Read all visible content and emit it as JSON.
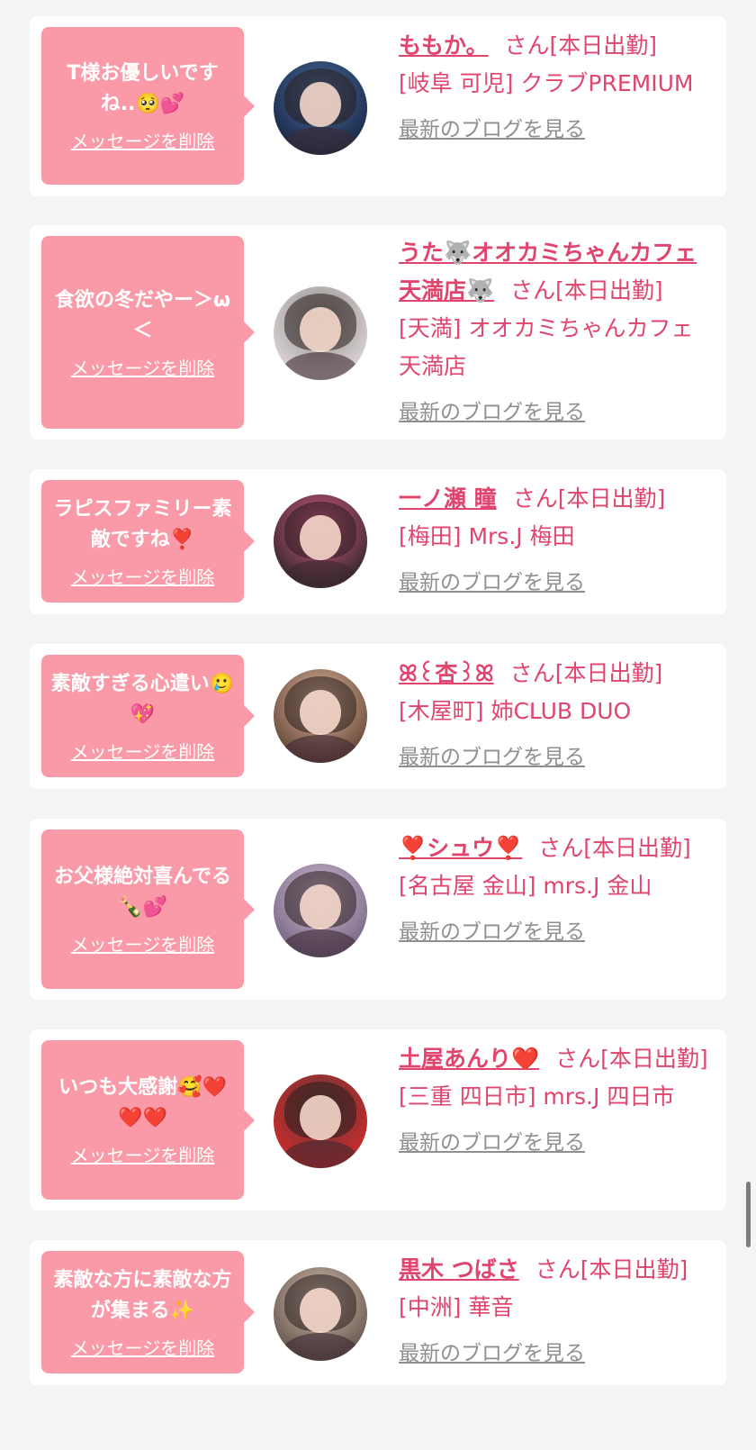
{
  "delete_label": "メッセージを削除",
  "blog_label": "最新のブログを見る",
  "san_suffix": "さん",
  "status_today": "[本日出勤]",
  "colors": {
    "bubble": "#fa9aa8",
    "accent": "#e0456e",
    "blog_link": "#8f8f8f"
  },
  "entries": [
    {
      "message": "T様お優しいですね..🥺💕",
      "cast_name": "ももか。",
      "shop": "[岐阜 可児] クラブPREMIUM",
      "avatar_colors": [
        "#1b2a4a",
        "#4c6fa0"
      ]
    },
    {
      "message": "食欲の冬だやー＞ω＜",
      "cast_name": "うた🐺オオカミちゃんカフェ天満店🐺",
      "shop": "[天満] オオカミちゃんカフェ天満店",
      "avatar_colors": [
        "#d9d3d3",
        "#8d8686"
      ]
    },
    {
      "message": "ラピスファミリー素敵ですね❣️",
      "cast_name": "一ノ瀬 瞳",
      "shop": "[梅田] Mrs.J 梅田",
      "avatar_colors": [
        "#3a2a30",
        "#e05a8a"
      ]
    },
    {
      "message": "素敵すぎる心遣い🥲💖",
      "cast_name": "ꕤ꒰杏꒱ꕤ",
      "shop": "[木屋町] 姉CLUB DUO",
      "avatar_colors": [
        "#6a4a3a",
        "#e8c2a8"
      ]
    },
    {
      "message": "お父様絶対喜んでる🍾💕",
      "cast_name": "❣️シュウ❣️",
      "shop": "[名古屋 金山] mrs.J 金山",
      "avatar_colors": [
        "#7a6a88",
        "#d8c2d8"
      ]
    },
    {
      "message": "いつも大感謝🥰❤️❤️❤️",
      "cast_name": "土屋あんり❤️",
      "shop": "[三重 四日市] mrs.J 四日市",
      "avatar_colors": [
        "#c92a2a",
        "#5a3a3a"
      ]
    },
    {
      "message": "素敵な方に素敵な方が集まる✨",
      "cast_name": "黒木 つばさ",
      "shop": "[中洲] 華音",
      "avatar_colors": [
        "#6b5a52",
        "#d8c4b4"
      ]
    }
  ]
}
